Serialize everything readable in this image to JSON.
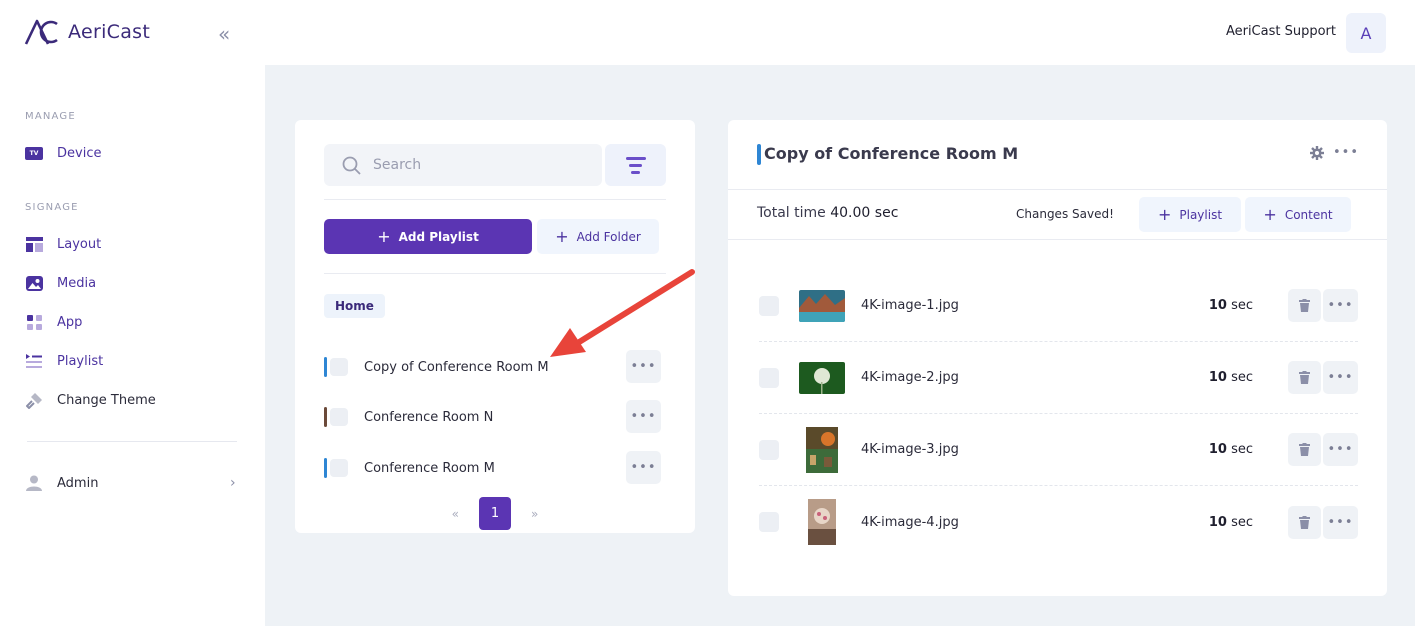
{
  "app": {
    "name": "AeriCast"
  },
  "sidebar": {
    "collapse_icon": "double-chevron-left-icon",
    "sections": [
      {
        "label": "MANAGE"
      },
      {
        "label": "SIGNAGE"
      }
    ],
    "items": [
      {
        "label": "Device",
        "icon": "tv-icon"
      },
      {
        "label": "Layout",
        "icon": "layout-icon"
      },
      {
        "label": "Media",
        "icon": "image-icon"
      },
      {
        "label": "App",
        "icon": "apps-grid-icon"
      },
      {
        "label": "Playlist",
        "icon": "playlist-icon"
      },
      {
        "label": "Change Theme",
        "icon": "paint-roller-icon"
      }
    ],
    "admin": {
      "label": "Admin",
      "icon": "user-icon"
    },
    "tv_badge": "TV"
  },
  "header": {
    "support_label": "AeriCast Support",
    "avatar_initial": "A"
  },
  "playlists_panel": {
    "search_placeholder": "Search",
    "add_playlist_label": "Add Playlist",
    "add_folder_label": "Add Folder",
    "breadcrumb": "Home",
    "playlists": [
      {
        "name": "Copy of Conference Room M",
        "color": "#2e86d4"
      },
      {
        "name": "Conference Room N",
        "color": "#6b4a3a"
      },
      {
        "name": "Conference Room M",
        "color": "#2e86d4"
      }
    ],
    "more_label": "•••",
    "pagination": {
      "prev": "«",
      "current": "1",
      "next": "»"
    }
  },
  "detail_panel": {
    "title": "Copy of Conference Room M",
    "total_label": "Total time",
    "total_value": "40.00",
    "total_unit": "sec",
    "status": "Changes Saved!",
    "add_playlist_label": "Playlist",
    "add_content_label": "Content",
    "more_label": "•••",
    "items": [
      {
        "name": "4K-image-1.jpg",
        "duration": "10",
        "unit": "sec"
      },
      {
        "name": "4K-image-2.jpg",
        "duration": "10",
        "unit": "sec"
      },
      {
        "name": "4K-image-3.jpg",
        "duration": "10",
        "unit": "sec"
      },
      {
        "name": "4K-image-4.jpg",
        "duration": "10",
        "unit": "sec"
      }
    ]
  },
  "colors": {
    "primary": "#5b35b3",
    "accent_blue": "#2e86d4",
    "annotation_arrow": "#e8443a"
  }
}
